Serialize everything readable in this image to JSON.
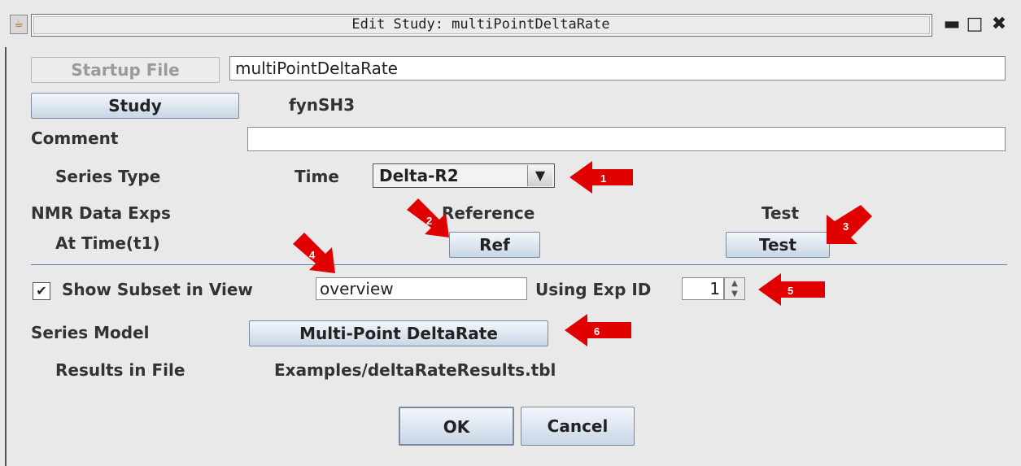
{
  "window": {
    "title": "Edit Study: multiPointDeltaRate",
    "app_icon": "java-icon",
    "controls": {
      "minimize": "minimize-icon",
      "maximize": "maximize-icon",
      "close": "close-icon"
    }
  },
  "startup": {
    "button_label": "Startup File",
    "value": "multiPointDeltaRate"
  },
  "study": {
    "button_label": "Study",
    "value": "fynSH3"
  },
  "comment": {
    "label": "Comment",
    "value": ""
  },
  "series_type": {
    "label": "Series Type",
    "time_label": "Time",
    "selected": "Delta-R2"
  },
  "nmr": {
    "label": "NMR Data Exps",
    "at_time_label": "At Time(t1)",
    "reference_label": "Reference",
    "test_label": "Test",
    "ref_button": "Ref",
    "test_button": "Test"
  },
  "subset": {
    "checked": true,
    "label": "Show Subset in View",
    "value": "overview",
    "expid_label": "Using Exp ID",
    "expid_value": "1"
  },
  "model": {
    "label": "Series Model",
    "button_label": "Multi-Point DeltaRate"
  },
  "results": {
    "label": "Results in File",
    "value": "Examples/deltaRateResults.tbl"
  },
  "actions": {
    "ok": "OK",
    "cancel": "Cancel"
  },
  "annotations": {
    "color": "#e10000",
    "markers": [
      "1",
      "2",
      "3",
      "4",
      "5",
      "6"
    ]
  }
}
